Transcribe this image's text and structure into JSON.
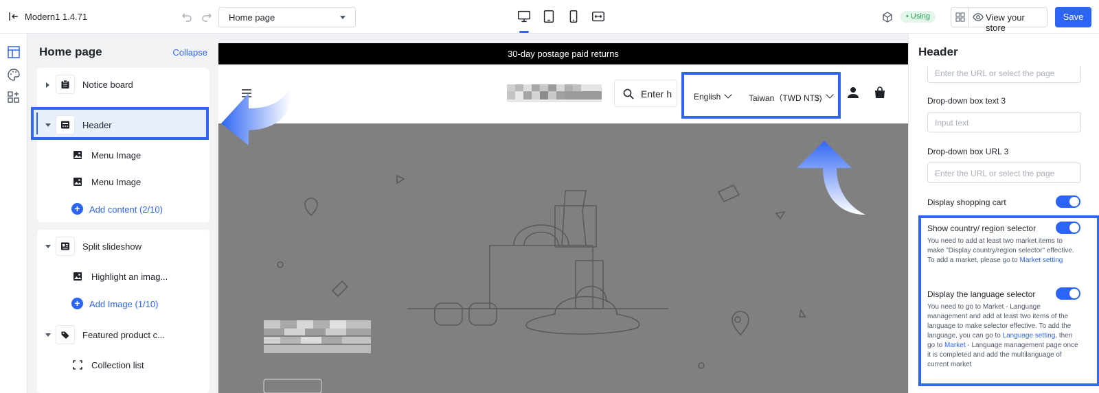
{
  "topbar": {
    "title": "Modern1  1.4.71",
    "page_select": "Home page",
    "status_badge": "• Using",
    "view_store": "View your store",
    "save": "Save"
  },
  "left_panel": {
    "title": "Home page",
    "collapse": "Collapse",
    "sections": [
      {
        "label": "Notice board"
      },
      {
        "label": "Header",
        "children": [
          "Menu Image",
          "Menu Image"
        ],
        "add": "Add content (2/10)"
      },
      {
        "label": "Split slideshow",
        "children": [
          "Highlight an imag..."
        ],
        "add": "Add Image (1/10)"
      },
      {
        "label": "Featured product c...",
        "children": [
          "Collection list"
        ]
      }
    ]
  },
  "preview": {
    "announcement": "30-day postage paid returns",
    "search_placeholder": "Enter h",
    "language": "English",
    "region": "Taiwan（TWD NT$)"
  },
  "right_panel": {
    "title": "Header",
    "url_placeholder_top": "Enter the URL or select the page",
    "dropdown_text_3_label": "Drop-down box text 3",
    "dropdown_text_3_placeholder": "Input text",
    "dropdown_url_3_label": "Drop-down box URL 3",
    "dropdown_url_3_placeholder": "Enter the URL or select the page",
    "display_cart_label": "Display shopping cart",
    "country_selector_label": "Show country/ region selector",
    "country_help": "You need to add at least two market items to make \"Display country/region selector\" effective. To add a market, please go to ",
    "country_help_link": "Market setting",
    "language_selector_label": "Display the language selector",
    "language_help_1": "You need to go to Market - Language management and add at least two items of the language to make selector effective. To add the language, you can go to ",
    "language_help_link1": "Language setting",
    "language_help_2": ", then go to ",
    "language_help_link2": "Market",
    "language_help_3": " - Language management page once it is completed and add the multilanguage of current market"
  },
  "colors": {
    "accent": "#2c64f6",
    "highlight": "#2f66f3",
    "hero_bg": "#808080"
  },
  "icons": [
    "exit-icon",
    "undo-icon",
    "redo-icon",
    "desktop-icon",
    "tablet-icon",
    "mobile-icon",
    "fullscreen-icon",
    "cube-icon",
    "grid-icon",
    "eye-icon",
    "layout-icon",
    "palette-icon",
    "apps-icon",
    "search-icon",
    "user-icon",
    "bag-icon",
    "hamburger-icon"
  ]
}
